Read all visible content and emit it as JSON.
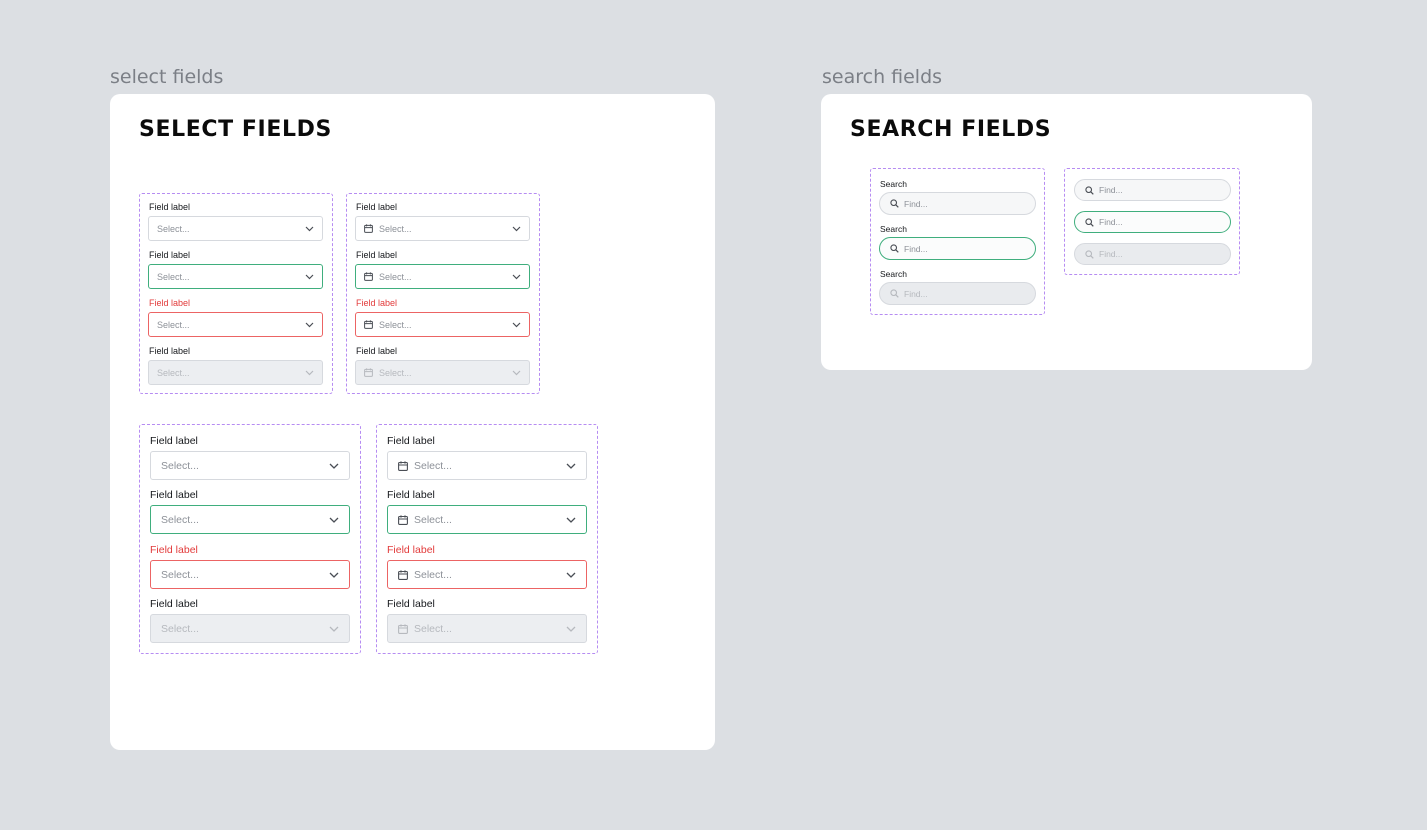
{
  "frames": {
    "select_label": "select fields",
    "search_label": "search fields"
  },
  "select_card": {
    "title": "SELECT FIELDS",
    "field_label": "Field label",
    "placeholder": "Select..."
  },
  "search_card": {
    "title": "SEARCH FIELDS",
    "field_label": "Search",
    "placeholder": "Find..."
  },
  "colors": {
    "canvas": "#dcdfe3",
    "card": "#ffffff",
    "group_outline": "#b68cf2",
    "focus": "#3fae7d",
    "error": "#e23b3b",
    "disabled_bg": "#eceef1"
  },
  "icons": {
    "chevron": "chevron-down-icon",
    "calendar": "calendar-icon",
    "search": "search-icon"
  }
}
